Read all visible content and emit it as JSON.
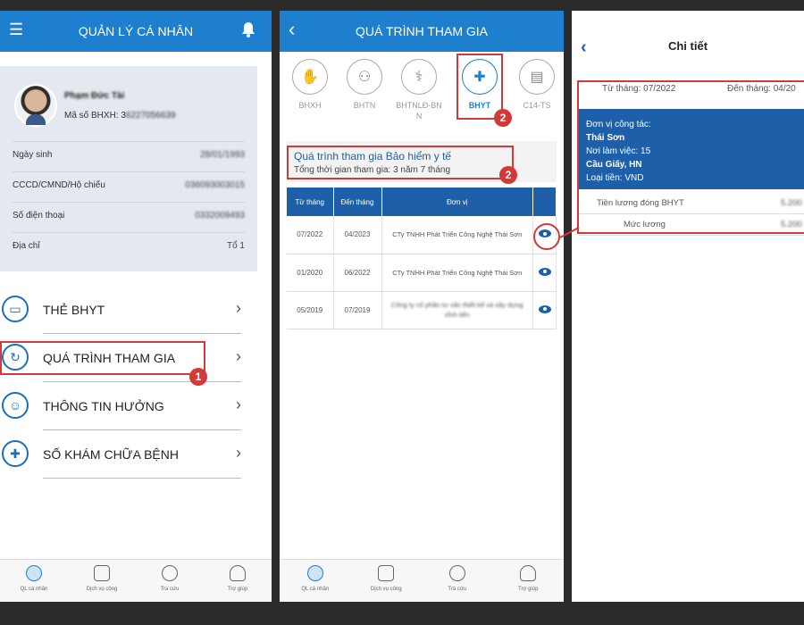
{
  "panel1": {
    "header": {
      "title": "QUẢN LÝ CÁ NHÂN",
      "menu_icon": "hamburger-icon",
      "bell_icon": "bell-icon"
    },
    "profile": {
      "name": "Phạm Đức Tài",
      "bhxh_label": "Mã số BHXH: 3",
      "bhxh_value": "6227056639"
    },
    "info_rows": [
      {
        "label": "Ngày sinh",
        "value": "28/01/1993"
      },
      {
        "label": "CCCD/CMND/Hộ chiếu",
        "value": "036093003015"
      },
      {
        "label": "Số điện thoại",
        "value": "0332009493"
      },
      {
        "label": "Địa chỉ",
        "value": "Tổ 1"
      }
    ],
    "menu": [
      {
        "label": "THẺ BHYT",
        "icon": "card-icon"
      },
      {
        "label": "QUÁ TRÌNH THAM GIA",
        "icon": "refresh-icon"
      },
      {
        "label": "THÔNG TIN HƯỞNG",
        "icon": "user-icon"
      },
      {
        "label": "SỐ KHÁM CHỮA BỆNH",
        "icon": "medical-cross-icon"
      }
    ],
    "step_badge": "1"
  },
  "panel2": {
    "header": {
      "title": "QUÁ TRÌNH THAM GIA",
      "back_icon": "chevron-left-icon"
    },
    "tabs": [
      {
        "label": "BHXH",
        "icon": "hands-icon"
      },
      {
        "label": "BHTN",
        "icon": "group-icon"
      },
      {
        "label": "BHTNLĐ-BNN",
        "icon": "worker-icon"
      },
      {
        "label": "BHYT",
        "icon": "medical-plus-icon"
      },
      {
        "label": "C14-TS",
        "icon": "document-icon"
      }
    ],
    "step_badge": "2",
    "summary": {
      "title": "Quá trình tham gia Bảo hiểm y tế",
      "subtitle": "Tổng thời gian tham gia: 3 năm 7 tháng"
    },
    "table": {
      "headers": [
        "Từ tháng",
        "Đến tháng",
        "Đơn vị",
        ""
      ],
      "rows": [
        {
          "from": "07/2022",
          "to": "04/2023",
          "unit": "CTy TNHH Phát Triển Công Nghệ Thái Sơn"
        },
        {
          "from": "01/2020",
          "to": "06/2022",
          "unit": "CTy TNHH Phát Triển Công Nghệ Thái Sơn"
        },
        {
          "from": "05/2019",
          "to": "07/2019",
          "unit": "Công ty cổ phần tư vấn thiết kế và xây dựng vĩnh tiến"
        }
      ]
    }
  },
  "panel3": {
    "title": "Chi tiết",
    "back_icon": "chevron-left-icon",
    "from": "Từ tháng: 07/2022",
    "to": "Đến tháng: 04/20",
    "block": {
      "unit_label": "Đơn vị công tác:",
      "unit_value": "Thái Sơn",
      "workplace_label": "Nơi làm việc: 15",
      "workplace_value": "Cầu Giấy, HN",
      "currency": "Loại tiền: VND"
    },
    "rows": [
      {
        "label": "Tiền lương đóng BHYT",
        "value": "5.200"
      },
      {
        "label": "Mức lương",
        "value": "5.200"
      }
    ]
  },
  "bottom_nav": [
    {
      "label": "QL cá nhân",
      "icon": "person-circle-icon"
    },
    {
      "label": "Dịch vụ công",
      "icon": "document-list-icon"
    },
    {
      "label": "Tra cứu",
      "icon": "search-gear-icon"
    },
    {
      "label": "Trợ giúp",
      "icon": "headset-icon"
    }
  ],
  "colors": {
    "primary": "#1d7fce",
    "dark_blue": "#1d5fa8",
    "highlight": "#d23a3a"
  }
}
